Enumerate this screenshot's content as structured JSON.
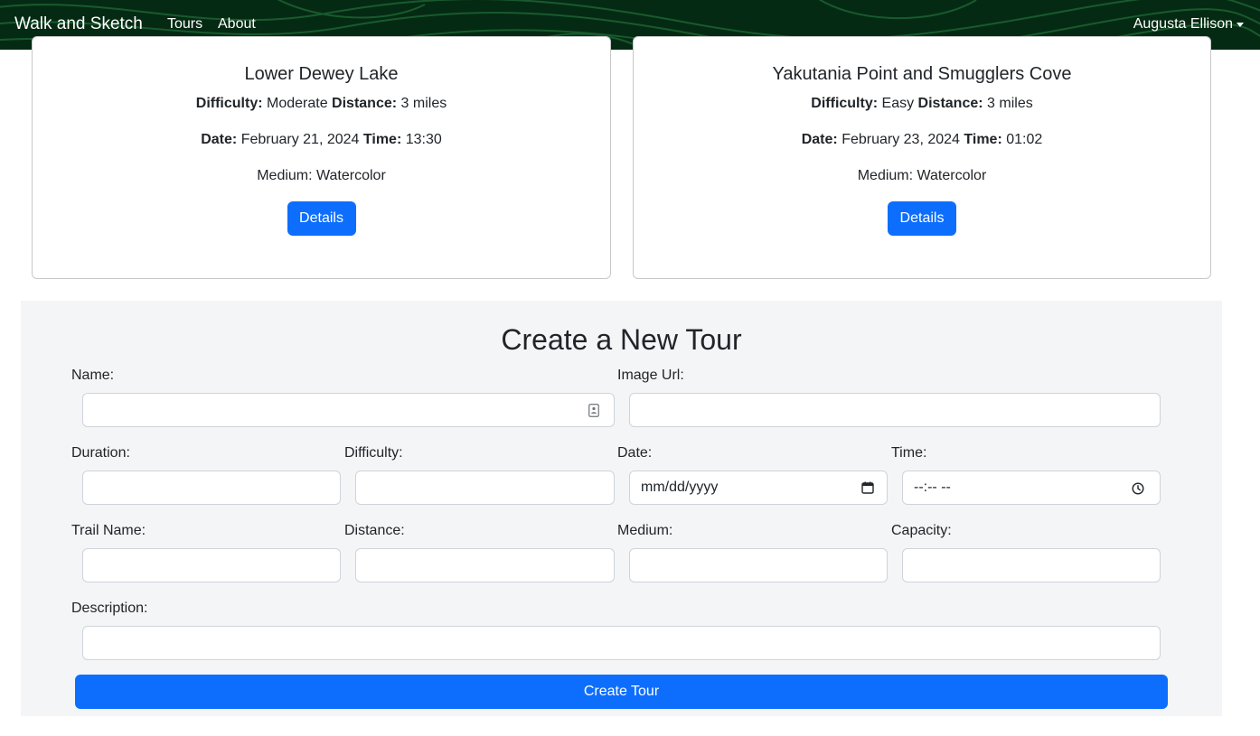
{
  "nav": {
    "brand": "Walk and Sketch",
    "links": [
      "Tours",
      "About"
    ],
    "user": "Augusta Ellison"
  },
  "tours": [
    {
      "title": "Lower Dewey Lake",
      "difficulty_label": "Difficulty:",
      "difficulty": "Moderate",
      "distance_label": "Distance:",
      "distance": "3 miles",
      "date_label": "Date:",
      "date": "February 21, 2024",
      "time_label": "Time:",
      "time": "13:30",
      "medium": "Medium: Watercolor",
      "button": "Details"
    },
    {
      "title": "Yakutania Point and Smugglers Cove",
      "difficulty_label": "Difficulty:",
      "difficulty": "Easy",
      "distance_label": "Distance:",
      "distance": "3 miles",
      "date_label": "Date:",
      "date": "February 23, 2024",
      "time_label": "Time:",
      "time": "01:02",
      "medium": "Medium: Watercolor",
      "button": "Details"
    }
  ],
  "form": {
    "title": "Create a New Tour",
    "labels": {
      "name": "Name:",
      "image_url": "Image Url:",
      "duration": "Duration:",
      "difficulty": "Difficulty:",
      "date": "Date:",
      "time": "Time:",
      "trail_name": "Trail Name:",
      "distance": "Distance:",
      "medium": "Medium:",
      "capacity": "Capacity:",
      "description": "Description:"
    },
    "placeholders": {
      "date": "mm/dd/yyyy",
      "time": "--:-- --"
    },
    "submit": "Create Tour"
  },
  "icons": [
    "contact-card-icon",
    "calendar-icon",
    "clock-icon",
    "caret-down-icon"
  ],
  "colors": {
    "primary": "#0d6efd",
    "navbar": "#052a13",
    "panel": "#f4f5f7"
  }
}
